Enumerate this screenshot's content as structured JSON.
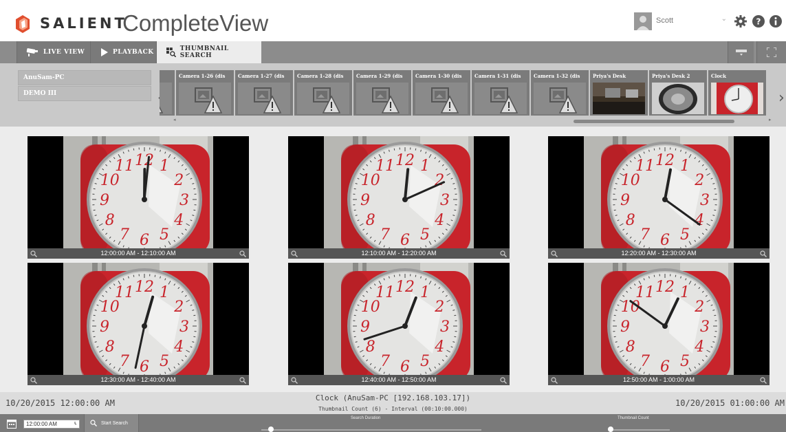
{
  "header": {
    "brand": "SALIENT",
    "product": "CompleteView",
    "user": "Scott"
  },
  "tabs": [
    {
      "label": "LIVE VIEW",
      "icon": "camera-icon"
    },
    {
      "label": "PLAYBACK",
      "icon": "play-icon"
    },
    {
      "label": "THUMBNAIL SEARCH",
      "icon": "thumbnail-search-icon",
      "active": true
    }
  ],
  "servers": [
    "AnuSam-PC",
    "DEMO III"
  ],
  "cameras": [
    {
      "label": "is",
      "status": "offline"
    },
    {
      "label": "Camera 1-26 (dis",
      "status": "offline"
    },
    {
      "label": "Camera 1-27 (dis",
      "status": "offline"
    },
    {
      "label": "Camera 1-28 (dis",
      "status": "offline"
    },
    {
      "label": "Camera 1-29 (dis",
      "status": "offline"
    },
    {
      "label": "Camera 1-30 (dis",
      "status": "offline"
    },
    {
      "label": "Camera 1-31 (dis",
      "status": "offline"
    },
    {
      "label": "Camera 1-32 (dis",
      "status": "offline"
    },
    {
      "label": "Priya's Desk",
      "status": "live"
    },
    {
      "label": "Priya's Desk 2",
      "status": "live"
    },
    {
      "label": "Clock",
      "status": "live"
    }
  ],
  "thumbnails": [
    {
      "caption": "12:00:00 AM - 12:10:00 AM",
      "hour": 12,
      "minute": 1
    },
    {
      "caption": "12:10:00 AM - 12:20:00 AM",
      "hour": 12,
      "minute": 11
    },
    {
      "caption": "12:20:00 AM - 12:30:00 AM",
      "hour": 12,
      "minute": 21
    },
    {
      "caption": "12:30:00 AM - 12:40:00 AM",
      "hour": 12,
      "minute": 32
    },
    {
      "caption": "12:40:00 AM - 12:50:00 AM",
      "hour": 12,
      "minute": 42
    },
    {
      "caption": "12:50:00 AM - 1:00:00 AM",
      "hour": 12,
      "minute": 51
    }
  ],
  "status": {
    "start": "10/20/2015 12:00:00 AM",
    "end": "10/20/2015 01:00:00 AM",
    "camera": "Clock (AnuSam-PC [192.168.103.17])",
    "summary": "Thumbnail Count (6) - Interval (00:10:00.000)"
  },
  "toolbar": {
    "time_value": "12:00:00 AM",
    "search_label": "Start Search",
    "duration_label": "Search Duration",
    "count_label": "Thumbnail Count"
  },
  "colors": {
    "tabbar": "#8c8c8c",
    "logo": "#e04e2e",
    "clock_red": "#d7262e"
  }
}
